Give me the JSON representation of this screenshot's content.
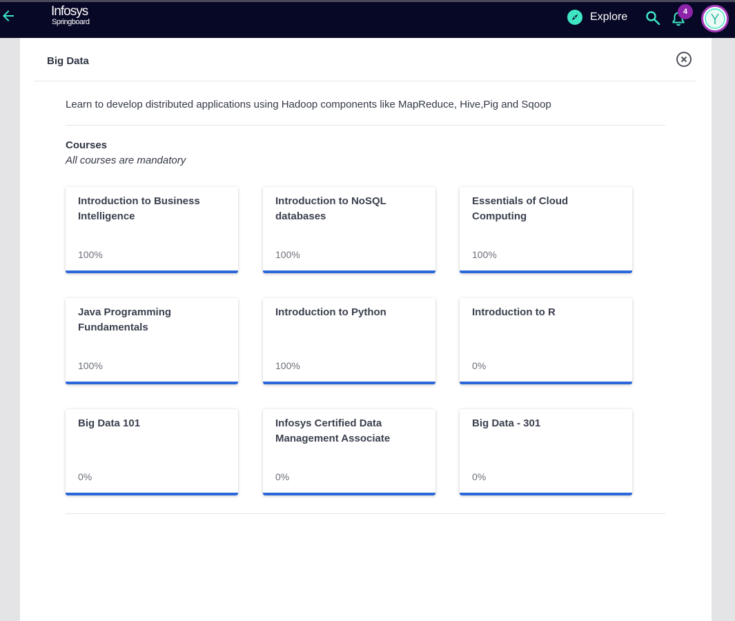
{
  "topbar": {
    "back_icon": "arrow-left-icon",
    "logo_line1": "Infosys",
    "logo_line2": "Springboard",
    "explore_label": "Explore",
    "explore_icon": "compass-icon",
    "search_icon": "search-icon",
    "bell_icon": "bell-icon",
    "notification_count": "4",
    "avatar_icon": "avatar-icon"
  },
  "panel": {
    "title": "Big Data",
    "close_icon": "close-circle-icon",
    "description": "Learn to develop distributed applications using Hadoop components like MapReduce, Hive,Pig and Sqoop",
    "courses_heading": "Courses",
    "courses_subheading": "All courses are mandatory",
    "courses": [
      {
        "title": "Introduction to Business Intelligence",
        "progress": "100%"
      },
      {
        "title": "Introduction to NoSQL databases",
        "progress": "100%"
      },
      {
        "title": "Essentials of Cloud Computing",
        "progress": "100%"
      },
      {
        "title": "Java Programming Fundamentals",
        "progress": "100%"
      },
      {
        "title": "Introduction to Python",
        "progress": "100%"
      },
      {
        "title": "Introduction to R",
        "progress": "0%"
      },
      {
        "title": "Big Data 101",
        "progress": "0%"
      },
      {
        "title": "Infosys Certified Data Management Associate",
        "progress": "0%"
      },
      {
        "title": "Big Data - 301",
        "progress": "0%"
      }
    ]
  },
  "colors": {
    "topbar_bg": "#070726",
    "accent_teal": "#3ee6c4",
    "progress_blue": "#2b67d9",
    "badge_purple": "#8e24aa"
  }
}
